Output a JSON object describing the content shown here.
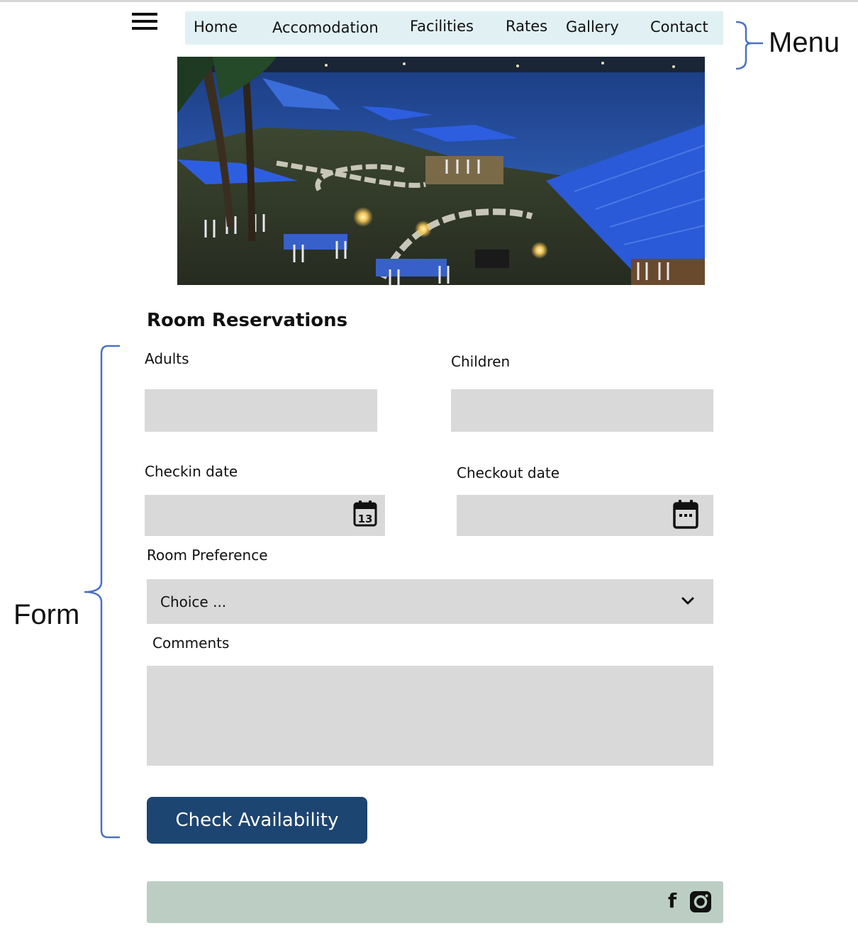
{
  "nav": {
    "menu_icon": "hamburger-menu-icon",
    "items": [
      {
        "label": "Home"
      },
      {
        "label": "Accomodation"
      },
      {
        "label": "Facilities"
      },
      {
        "label": "Rates"
      },
      {
        "label": "Gallery"
      },
      {
        "label": "Contact"
      }
    ]
  },
  "annotations": {
    "menu": "Menu",
    "form": "Form",
    "bracket_color": "#4a72c4"
  },
  "hero": {
    "alt": "Lakeside restaurant terrace with blue umbrellas at night"
  },
  "form": {
    "title": "Room Reservations",
    "adults": {
      "label": "Adults",
      "value": ""
    },
    "children": {
      "label": "Children",
      "value": ""
    },
    "checkin": {
      "label": "Checkin date",
      "value": "",
      "icon": "calendar-13-icon"
    },
    "checkout": {
      "label": "Checkout date",
      "value": "",
      "icon": "calendar-icon"
    },
    "room_preference": {
      "label": "Room Preference",
      "selected": "Choice ..."
    },
    "comments": {
      "label": "Comments",
      "value": ""
    },
    "submit_label": "Check Availability"
  },
  "footer": {
    "icons": [
      "facebook-icon",
      "instagram-icon"
    ],
    "facebook_glyph": "f"
  },
  "colors": {
    "nav_bg": "#e1f1f3",
    "field_bg": "#d9d9d9",
    "button_bg": "#1d4571",
    "footer_bg": "#bccec4"
  }
}
